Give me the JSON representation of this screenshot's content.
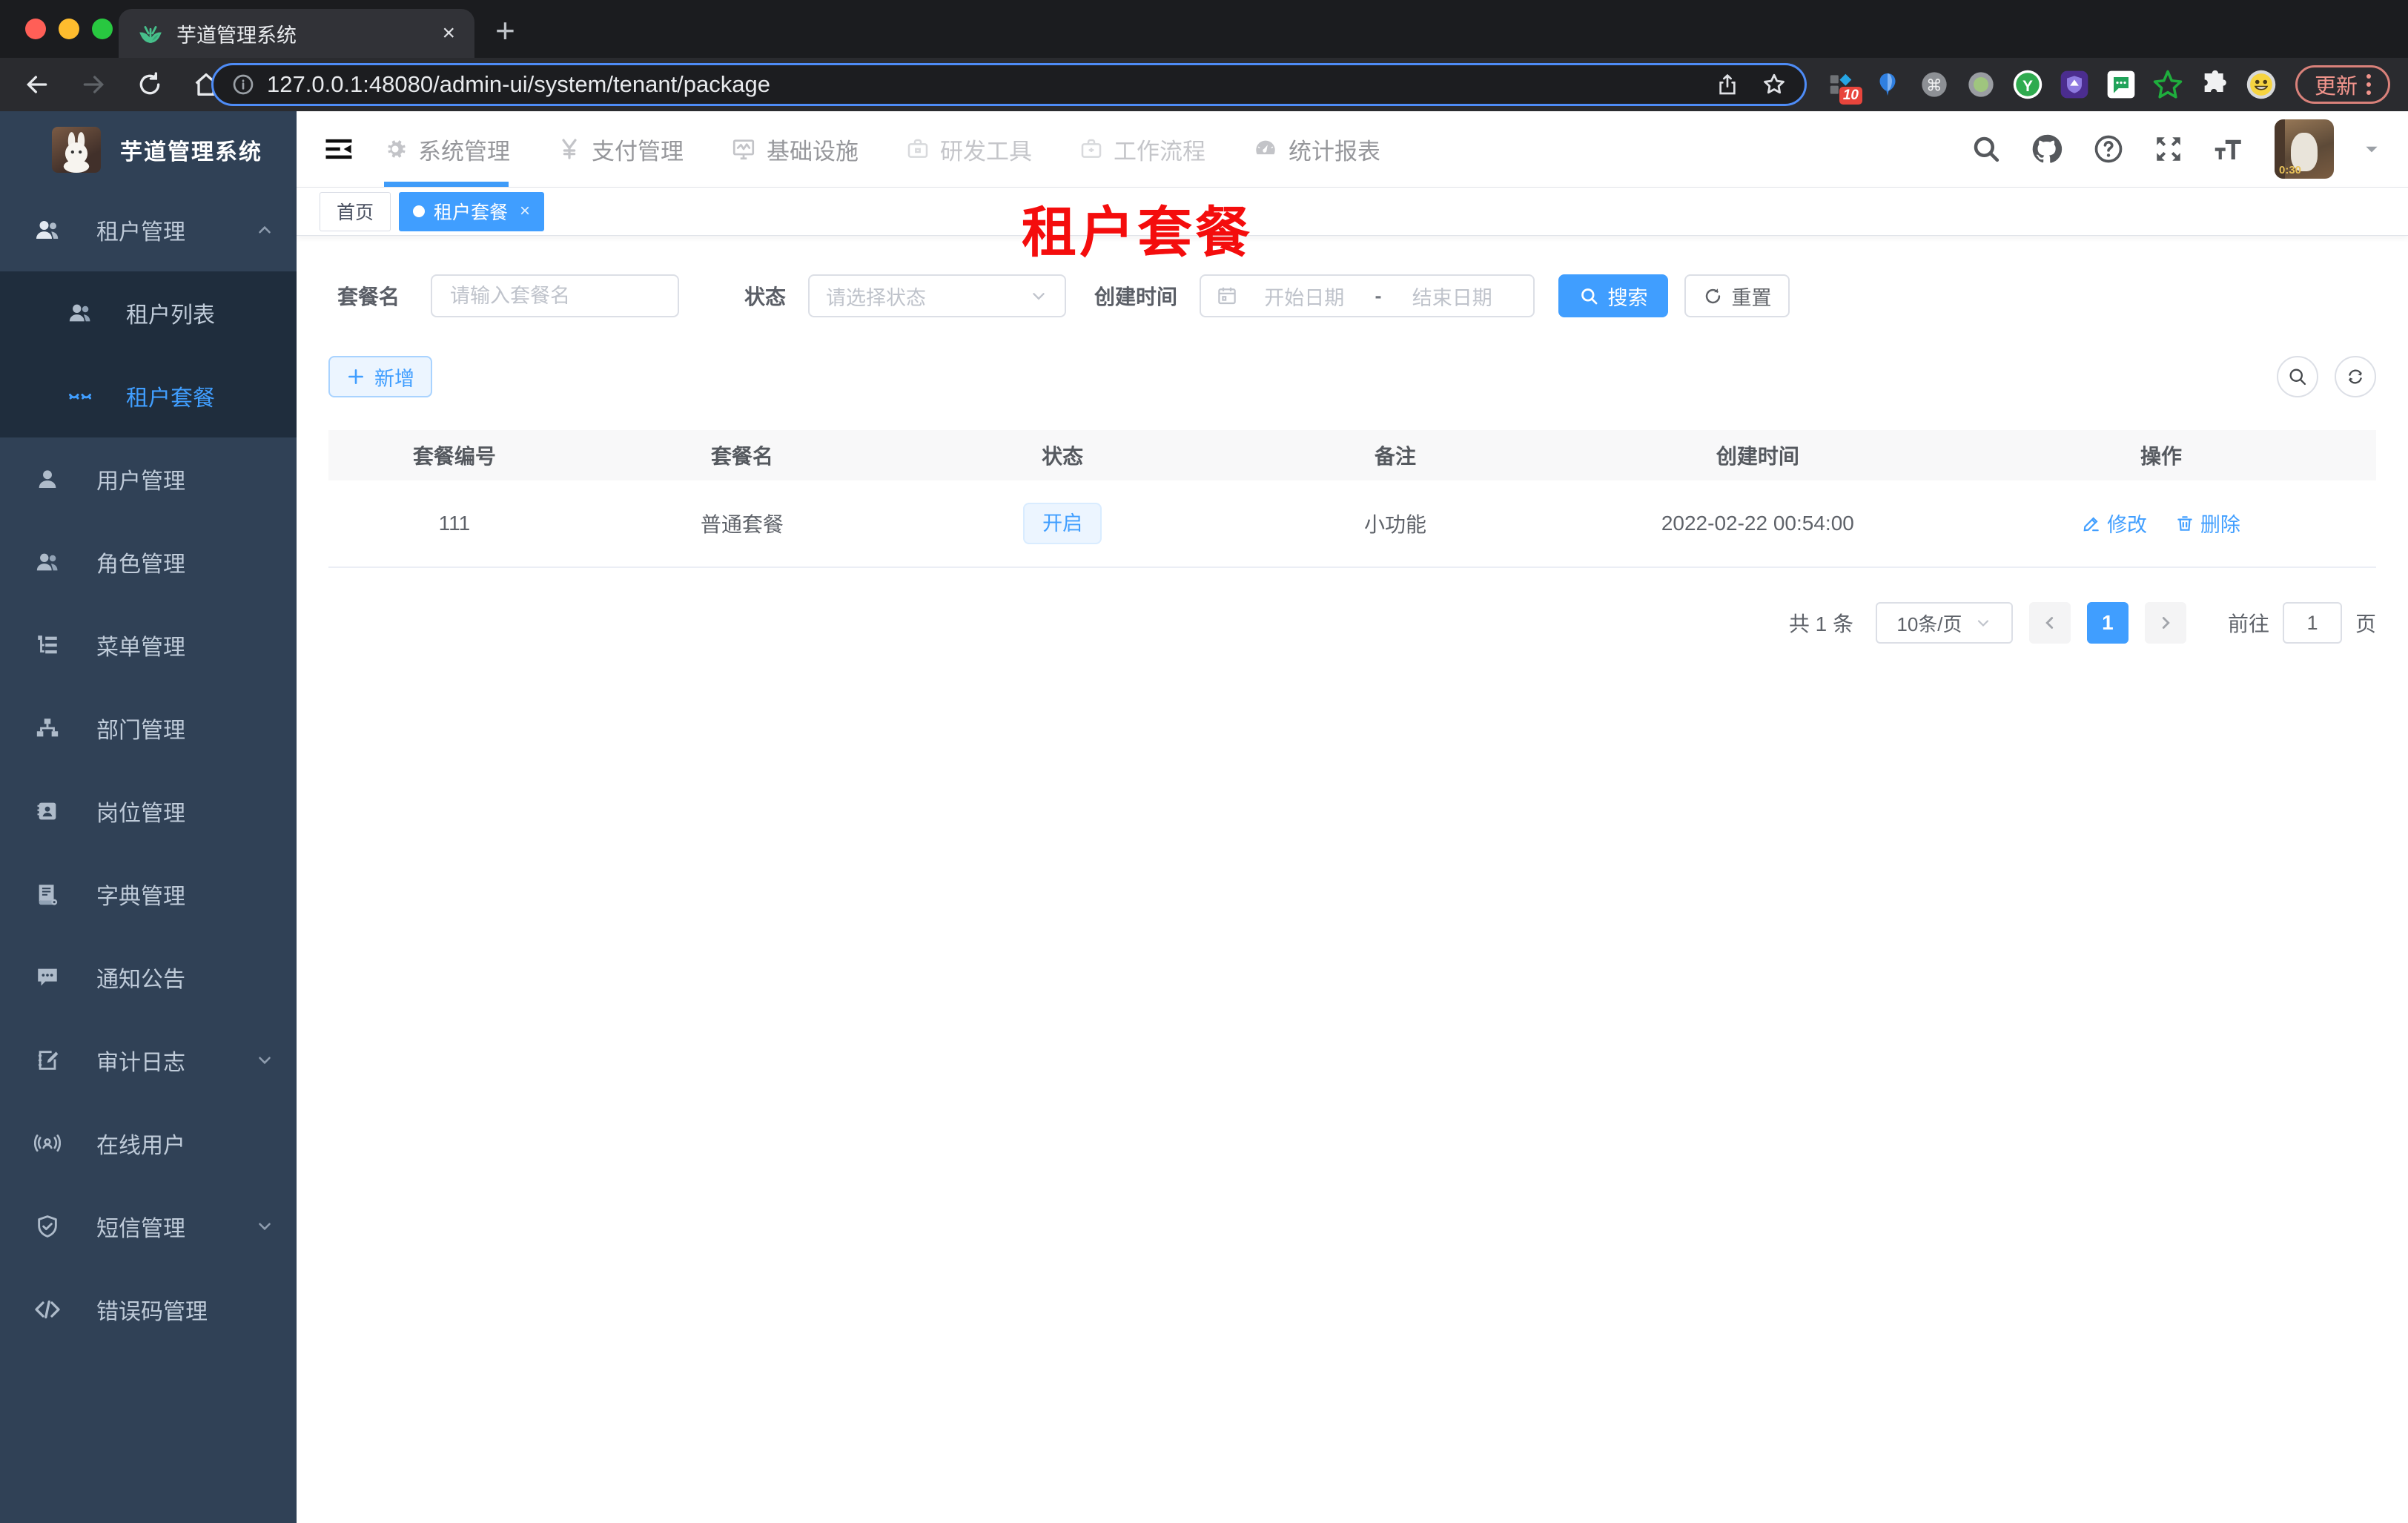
{
  "browser": {
    "tab_title": "芋道管理系统",
    "close_tab": "×",
    "new_tab": "+",
    "url": "127.0.0.1:48080/admin-ui/system/tenant/package",
    "extension_badge": "10",
    "update_label": "更新"
  },
  "sidebar": {
    "app_title": "芋道管理系统",
    "items": [
      {
        "label": "租户管理"
      },
      {
        "label": "租户列表"
      },
      {
        "label": "租户套餐"
      },
      {
        "label": "用户管理"
      },
      {
        "label": "角色管理"
      },
      {
        "label": "菜单管理"
      },
      {
        "label": "部门管理"
      },
      {
        "label": "岗位管理"
      },
      {
        "label": "字典管理"
      },
      {
        "label": "通知公告"
      },
      {
        "label": "审计日志"
      },
      {
        "label": "在线用户"
      },
      {
        "label": "短信管理"
      },
      {
        "label": "错误码管理"
      }
    ]
  },
  "topnav": {
    "items": [
      "系统管理",
      "支付管理",
      "基础设施",
      "研发工具",
      "工作流程",
      "统计报表"
    ]
  },
  "header_right": {
    "avatar_caption": "0:30"
  },
  "tags": {
    "home": "首页",
    "active": "租户套餐",
    "close": "×"
  },
  "overlay_title": "租户套餐",
  "filters": {
    "name_label": "套餐名",
    "name_placeholder": "请输入套餐名",
    "status_label": "状态",
    "status_placeholder": "请选择状态",
    "date_label": "创建时间",
    "date_start_placeholder": "开始日期",
    "date_separator": "-",
    "date_end_placeholder": "结束日期",
    "search_label": "搜索",
    "reset_label": "重置"
  },
  "toolbar": {
    "add_label": "新增"
  },
  "table": {
    "headers": [
      "套餐编号",
      "套餐名",
      "状态",
      "备注",
      "创建时间",
      "操作"
    ],
    "rows": [
      {
        "id": "111",
        "name": "普通套餐",
        "status": "开启",
        "remark": "小功能",
        "created": "2022-02-22 00:54:00",
        "edit_label": "修改",
        "delete_label": "删除"
      }
    ]
  },
  "pagination": {
    "total": "共 1 条",
    "page_size": "10条/页",
    "current_page": "1",
    "goto_label": "前往",
    "goto_value": "1",
    "page_label": "页"
  },
  "colors": {
    "accent": "#409eff",
    "overlay_red": "#f40d0d",
    "sidebar_bg": "#304156",
    "submenu_bg": "#1f2d3d"
  }
}
